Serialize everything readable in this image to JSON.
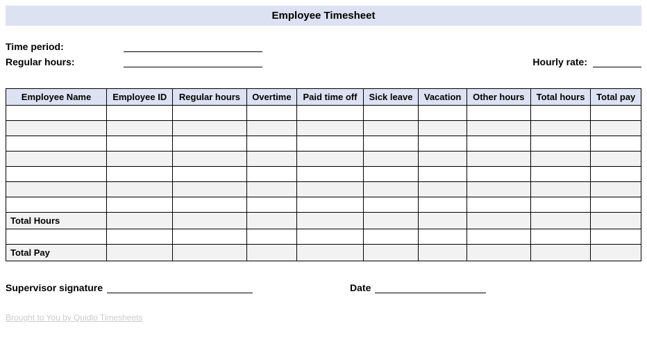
{
  "title": "Employee Timesheet",
  "fields": {
    "time_period_label": "Time period:",
    "regular_hours_label": "Regular hours:",
    "hourly_rate_label": "Hourly rate:"
  },
  "table": {
    "headers": [
      "Employee Name",
      "Employee ID",
      "Regular hours",
      "Overtime",
      "Paid time off",
      "Sick leave",
      "Vacation",
      "Other hours",
      "Total hours",
      "Total pay"
    ],
    "total_hours_label": "Total Hours",
    "total_pay_label": "Total Pay"
  },
  "signature": {
    "supervisor_label": "Supervisor signature",
    "date_label": "Date"
  },
  "footer": "Brought to You by Quidlo Timesheets"
}
